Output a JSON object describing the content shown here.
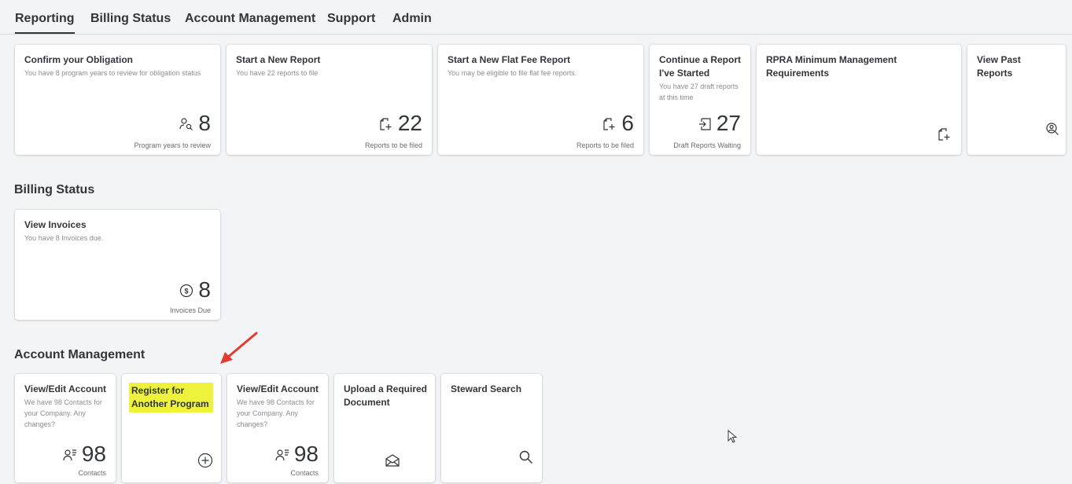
{
  "tabs": [
    {
      "label": "Reporting"
    },
    {
      "label": "Billing Status"
    },
    {
      "label": "Account Management"
    },
    {
      "label": "Support"
    },
    {
      "label": "Admin"
    }
  ],
  "reporting": {
    "tiles": [
      {
        "title": "Confirm your Obligation",
        "subtitle": "You have 8 program years to review for obligation status",
        "value": "8",
        "footer": "Program years to review",
        "icon": "people-search-icon"
      },
      {
        "title": "Start a New Report",
        "subtitle": "You have 22 reports to file",
        "value": "22",
        "footer": "Reports to be filed",
        "icon": "add-document-icon"
      },
      {
        "title": "Start a New Flat Fee Report",
        "subtitle": "You may be eligible to file flat fee reports.",
        "value": "6",
        "footer": "Reports to be filed",
        "icon": "add-document-icon"
      },
      {
        "title": "Continue a Report I've Started",
        "subtitle": "You have 27 draft reports at this time",
        "value": "27",
        "footer": "Draft Reports Waiting",
        "icon": "document-arrow-icon"
      },
      {
        "title": "RPRA Minimum Management Requirements",
        "icon": "add-document-icon"
      },
      {
        "title": "View Past Reports",
        "icon": "person-search-icon"
      }
    ]
  },
  "billing": {
    "heading": "Billing Status",
    "tiles": [
      {
        "title": "View Invoices",
        "subtitle": "You have 8 Invoices due.",
        "value": "8",
        "footer": "Invoices Due",
        "icon": "dollar-circle-icon"
      }
    ]
  },
  "account": {
    "heading": "Account Management",
    "tiles": [
      {
        "title": "View/Edit Account",
        "subtitle": "We have 98 Contacts for your Company. Any changes?",
        "value": "98",
        "footer": "Contacts",
        "icon": "contacts-list-icon"
      },
      {
        "title": "Register for Another Program",
        "icon": "add-circle-icon",
        "highlight_color": "#eef23b"
      },
      {
        "title": "View/Edit Account",
        "subtitle": "We have 98 Contacts for your Company. Any changes?",
        "value": "98",
        "footer": "Contacts",
        "icon": "contacts-list-icon"
      },
      {
        "title": "Upload a Required Document",
        "icon": "envelope-icon"
      },
      {
        "title": "Steward Search",
        "icon": "search-icon"
      }
    ]
  },
  "colors": {
    "annotation_arrow": "#e03c31",
    "highlight": "#eef23b"
  }
}
